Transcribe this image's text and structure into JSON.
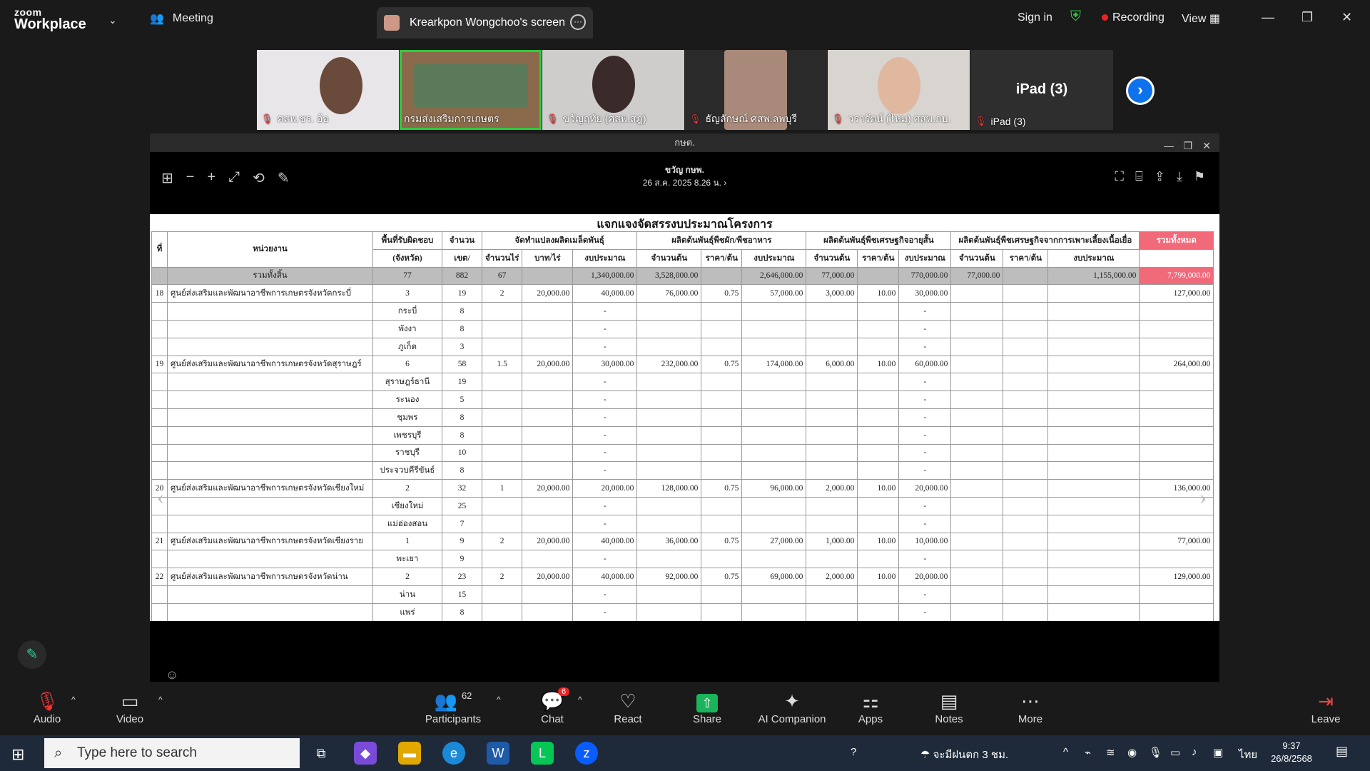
{
  "app": {
    "brand_top": "zoom",
    "brand_bottom": "Workplace",
    "meeting_label": "Meeting",
    "share_tab": "Krearkpon Wongchoo's screen",
    "sign_in": "Sign in",
    "recording": "Recording",
    "view": "View"
  },
  "participants": [
    {
      "name": "ศสพ.ชร. อ้อ"
    },
    {
      "name": "กรมส่งเสริมการเกษตร"
    },
    {
      "name": "ขวัญฤทัย (ศสพ.สฎ)"
    },
    {
      "name": "ธัญลักษณ์ ศสพ.ลพบุรี"
    },
    {
      "name": "วรารัตน์ (ไหม) ศสพ.กบ."
    },
    {
      "name": "iPad (3)",
      "big_label": "iPad (3)"
    }
  ],
  "shared_window": {
    "title": "กษต.",
    "doc_sender": "ขวัญ กษพ.",
    "doc_date": "26 ส.ค. 2025 8.26 น. ›"
  },
  "sheet": {
    "title": "แจกแจงจัดสรรงบประมาณโครงการ",
    "headers": {
      "no": "ที่",
      "unit": "หน่วยงาน",
      "area_top": "พื้นที่รับผิดชอบ",
      "area_bottom": "(จังหวัด)",
      "count_top": "จำนวน",
      "count_bottom": "เขต/",
      "g1": "จัดทำแปลงผลิตเมล็ดพันธุ์",
      "g2": "ผลิตต้นพันธุ์พืชผัก/พืชอาหาร",
      "g3": "ผลิตต้นพันธุ์พืชเศรษฐกิจอายุสั้น",
      "g4": "ผลิตต้นพันธุ์พืชเศรษฐกิจจากการเพาะเลี้ยงเนื้อเยื่อ",
      "total": "รวมทั้งหมด",
      "g1_c1": "จำนวนไร่",
      "g1_c2": "บาท/ไร่",
      "g1_c3": "งบประมาณ",
      "g2_c1": "จำนวนต้น",
      "g2_c2": "ราคา/ต้น",
      "g2_c3": "งบประมาณ",
      "g3_c1": "จำนวนต้น",
      "g3_c2": "ราคา/ต้น",
      "g3_c3": "งบประมาณ",
      "g4_c1": "จำนวนต้น",
      "g4_c2": "ราคา/ต้น",
      "g4_c3": "งบประมาณ"
    },
    "rows": [
      {
        "type": "total",
        "cells": [
          "",
          "รวมทั้งสิ้น",
          "77",
          "882",
          "67",
          "",
          "1,340,000.00",
          "3,528,000.00",
          "",
          "2,646,000.00",
          "77,000.00",
          "",
          "770,000.00",
          "77,000.00",
          "",
          "1,155,000.00",
          "7,799,000.00"
        ]
      },
      {
        "cells": [
          "18",
          "ศูนย์ส่งเสริมและพัฒนาอาชีพการเกษตรจังหวัดกระบี่",
          "3",
          "19",
          "2",
          "20,000.00",
          "40,000.00",
          "76,000.00",
          "0.75",
          "57,000.00",
          "3,000.00",
          "10.00",
          "30,000.00",
          "",
          "",
          "",
          "127,000.00"
        ]
      },
      {
        "cells": [
          "",
          "",
          "กระบี่",
          "8",
          "",
          "",
          "-",
          "",
          "",
          "",
          "",
          "",
          "-",
          "",
          "",
          "",
          ""
        ]
      },
      {
        "cells": [
          "",
          "",
          "พังงา",
          "8",
          "",
          "",
          "-",
          "",
          "",
          "",
          "",
          "",
          "-",
          "",
          "",
          "",
          ""
        ]
      },
      {
        "cells": [
          "",
          "",
          "ภูเก็ต",
          "3",
          "",
          "",
          "-",
          "",
          "",
          "",
          "",
          "",
          "-",
          "",
          "",
          "",
          ""
        ]
      },
      {
        "cells": [
          "19",
          "ศูนย์ส่งเสริมและพัฒนาอาชีพการเกษตรจังหวัดสุราษฎร์",
          "6",
          "58",
          "1.5",
          "20,000.00",
          "30,000.00",
          "232,000.00",
          "0.75",
          "174,000.00",
          "6,000.00",
          "10.00",
          "60,000.00",
          "",
          "",
          "",
          "264,000.00"
        ]
      },
      {
        "cells": [
          "",
          "",
          "สุราษฎร์ธานี",
          "19",
          "",
          "",
          "-",
          "",
          "",
          "",
          "",
          "",
          "-",
          "",
          "",
          "",
          ""
        ]
      },
      {
        "cells": [
          "",
          "",
          "ระนอง",
          "5",
          "",
          "",
          "-",
          "",
          "",
          "",
          "",
          "",
          "-",
          "",
          "",
          "",
          ""
        ]
      },
      {
        "cells": [
          "",
          "",
          "ชุมพร",
          "8",
          "",
          "",
          "-",
          "",
          "",
          "",
          "",
          "",
          "-",
          "",
          "",
          "",
          ""
        ]
      },
      {
        "cells": [
          "",
          "",
          "เพชรบุรี",
          "8",
          "",
          "",
          "-",
          "",
          "",
          "",
          "",
          "",
          "-",
          "",
          "",
          "",
          ""
        ]
      },
      {
        "cells": [
          "",
          "",
          "ราชบุรี",
          "10",
          "",
          "",
          "-",
          "",
          "",
          "",
          "",
          "",
          "-",
          "",
          "",
          "",
          ""
        ]
      },
      {
        "cells": [
          "",
          "",
          "ประจวบคีรีขันธ์",
          "8",
          "",
          "",
          "-",
          "",
          "",
          "",
          "",
          "",
          "-",
          "",
          "",
          "",
          ""
        ]
      },
      {
        "cells": [
          "20",
          "ศูนย์ส่งเสริมและพัฒนาอาชีพการเกษตรจังหวัดเชียงใหม่",
          "2",
          "32",
          "1",
          "20,000.00",
          "20,000.00",
          "128,000.00",
          "0.75",
          "96,000.00",
          "2,000.00",
          "10.00",
          "20,000.00",
          "",
          "",
          "",
          "136,000.00"
        ]
      },
      {
        "cells": [
          "",
          "",
          "เชียงใหม่",
          "25",
          "",
          "",
          "-",
          "",
          "",
          "",
          "",
          "",
          "-",
          "",
          "",
          "",
          ""
        ]
      },
      {
        "cells": [
          "",
          "",
          "แม่ฮ่องสอน",
          "7",
          "",
          "",
          "-",
          "",
          "",
          "",
          "",
          "",
          "-",
          "",
          "",
          "",
          ""
        ]
      },
      {
        "cells": [
          "21",
          "ศูนย์ส่งเสริมและพัฒนาอาชีพการเกษตรจังหวัดเชียงราย",
          "1",
          "9",
          "2",
          "20,000.00",
          "40,000.00",
          "36,000.00",
          "0.75",
          "27,000.00",
          "1,000.00",
          "10.00",
          "10,000.00",
          "",
          "",
          "",
          "77,000.00"
        ]
      },
      {
        "cells": [
          "",
          "",
          "พะเยา",
          "9",
          "",
          "",
          "-",
          "",
          "",
          "",
          "",
          "",
          "-",
          "",
          "",
          "",
          ""
        ]
      },
      {
        "cells": [
          "22",
          "ศูนย์ส่งเสริมและพัฒนาอาชีพการเกษตรจังหวัดน่าน",
          "2",
          "23",
          "2",
          "20,000.00",
          "40,000.00",
          "92,000.00",
          "0.75",
          "69,000.00",
          "2,000.00",
          "10.00",
          "20,000.00",
          "",
          "",
          "",
          "129,000.00"
        ]
      },
      {
        "cells": [
          "",
          "",
          "น่าน",
          "15",
          "",
          "",
          "-",
          "",
          "",
          "",
          "",
          "",
          "-",
          "",
          "",
          "",
          ""
        ]
      },
      {
        "cells": [
          "",
          "",
          "แพร่",
          "8",
          "",
          "",
          "-",
          "",
          "",
          "",
          "",
          "",
          "-",
          "",
          "",
          "",
          ""
        ]
      }
    ]
  },
  "controls": {
    "audio": "Audio",
    "video": "Video",
    "participants": "Participants",
    "participants_count": "62",
    "chat": "Chat",
    "chat_badge": "6",
    "react": "React",
    "share": "Share",
    "ai": "AI Companion",
    "apps": "Apps",
    "notes": "Notes",
    "more": "More",
    "leave": "Leave"
  },
  "taskbar": {
    "search_placeholder": "Type here to search",
    "weather": "จะมีฝนตก 3 ชม.",
    "lang": "ไทย",
    "time": "9:37",
    "date": "26/8/2568"
  },
  "colors": {
    "accent_blue": "#0e72ed",
    "recording_red": "#e22222",
    "share_green": "#1bb45a",
    "total_highlight": "#f06a7a",
    "active_tile": "#2ecc40"
  }
}
